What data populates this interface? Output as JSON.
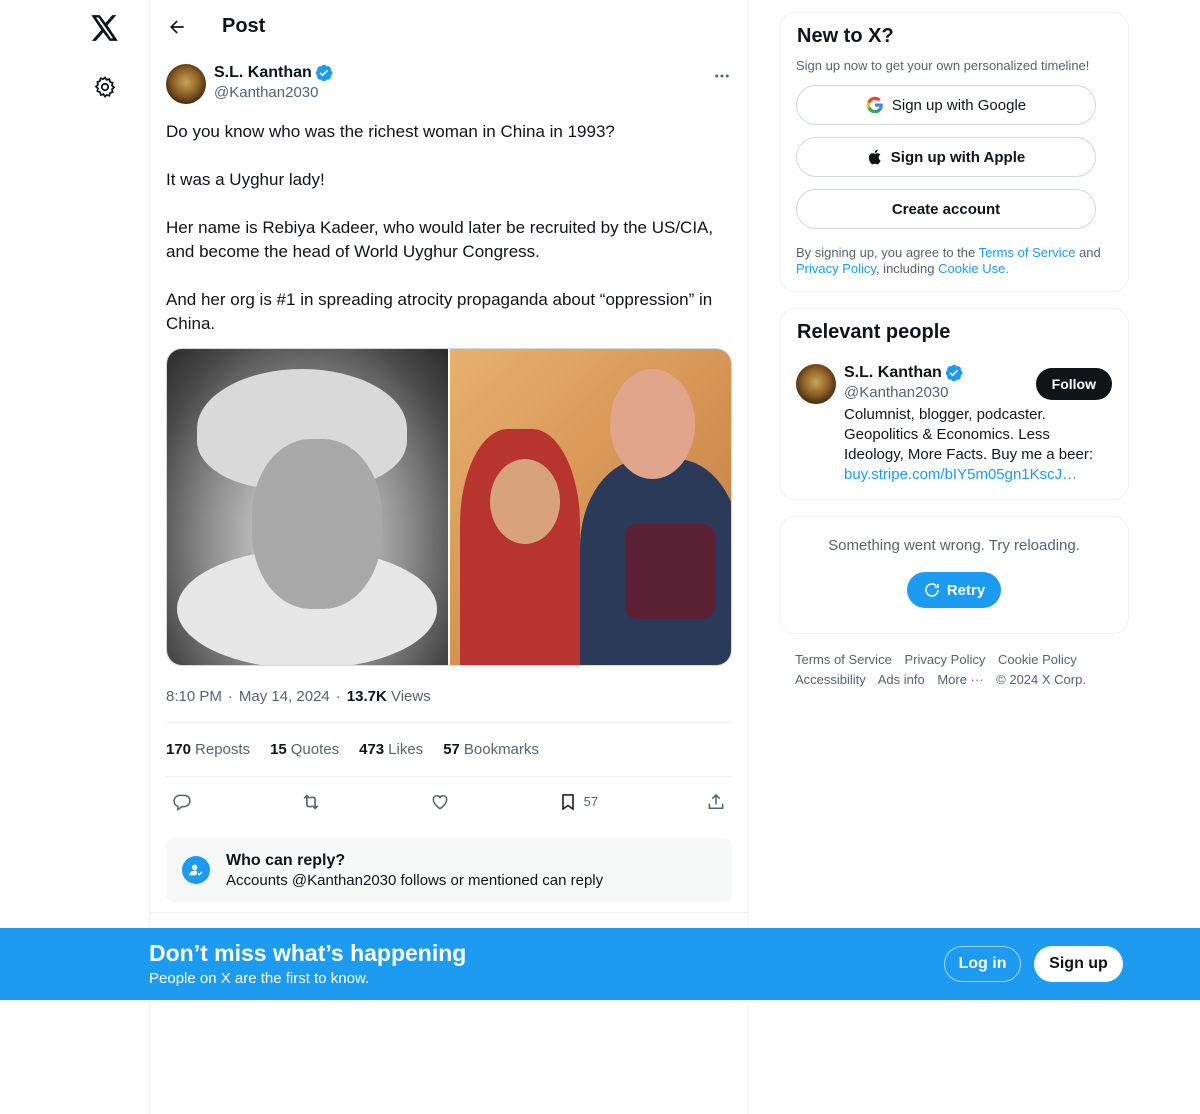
{
  "nav": {
    "logo_icon": "x-logo-icon",
    "settings_icon": "gear-icon"
  },
  "header": {
    "title": "Post"
  },
  "post": {
    "author_name": "S.L. Kanthan",
    "author_handle": "@Kanthan2030",
    "text": "Do you know who was the richest woman in China in 1993?\n\nIt was a Uyghur lady!\n\nHer name is Rebiya Kadeer, who would later be recruited by the US/CIA, and become the head of World Uyghur Congress.\n\nAnd her org is #1 in spreading atrocity propaganda about “oppression” in China.",
    "time": "8:10 PM",
    "date": "May 14, 2024",
    "views_count": "13.7K",
    "views_label": "Views",
    "stats": {
      "reposts_count": "170",
      "reposts_label": "Reposts",
      "quotes_count": "15",
      "quotes_label": "Quotes",
      "likes_count": "473",
      "likes_label": "Likes",
      "bookmarks_count": "57",
      "bookmarks_label": "Bookmarks"
    },
    "actions": {
      "bookmark_count": "57"
    },
    "who_can_reply": {
      "title": "Who can reply?",
      "subtitle": "Accounts @Kanthan2030 follows or mentioned can reply"
    }
  },
  "sidebar": {
    "signup_card": {
      "title": "New to X?",
      "subtitle": "Sign up now to get your own personalized timeline!",
      "google_label": "Sign up with Google",
      "apple_label": "Sign up with Apple",
      "create_label": "Create account",
      "legal_prefix": "By signing up, you agree to the",
      "terms_link": "Terms of Service",
      "legal_and": "and",
      "privacy_link": "Privacy Policy",
      "legal_including": ", including",
      "cookie_link": "Cookie Use."
    },
    "relevant_people": {
      "title": "Relevant people",
      "name": "S.L. Kanthan",
      "handle": "@Kanthan2030",
      "follow_label": "Follow",
      "bio": "Columnist, blogger, podcaster. Geopolitics & Economics. Less Ideology, More Facts. Buy me a beer:",
      "bio_link": "buy.stripe.com/bIY5m05gn1KscJ…"
    },
    "error_card": {
      "message": "Something went wrong. Try reloading.",
      "retry_label": "Retry"
    },
    "footer": {
      "terms": "Terms of Service",
      "privacy": "Privacy Policy",
      "cookie": "Cookie Policy",
      "accessibility": "Accessibility",
      "ads": "Ads info",
      "more": "More ···",
      "copyright": "© 2024 X Corp."
    }
  },
  "banner": {
    "title": "Don’t miss what’s happening",
    "subtitle": "People on X are the first to know.",
    "login_label": "Log in",
    "signup_label": "Sign up"
  },
  "colors": {
    "accent": "#1d9bf0",
    "text": "#0f1419",
    "muted": "#536471"
  }
}
